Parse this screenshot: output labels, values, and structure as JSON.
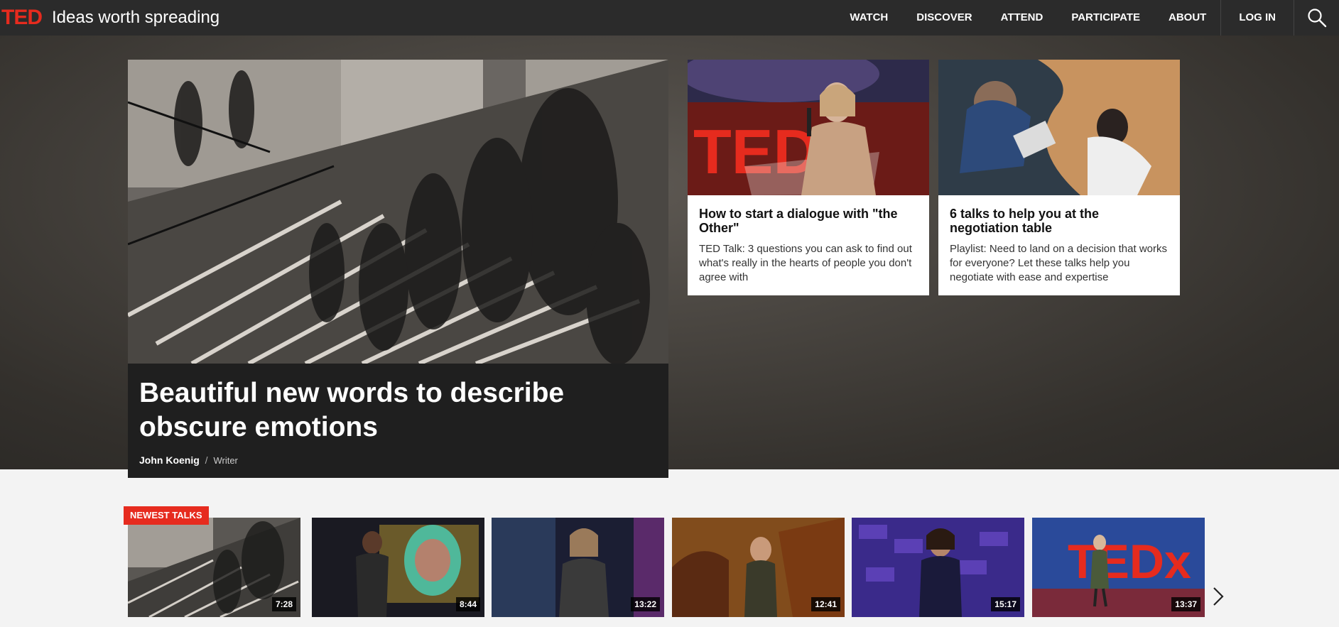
{
  "header": {
    "logo": "TED",
    "tagline": "Ideas worth spreading",
    "nav": [
      "WATCH",
      "DISCOVER",
      "ATTEND",
      "PARTICIPATE",
      "ABOUT"
    ],
    "login": "LOG IN",
    "search_icon": "search-icon"
  },
  "feature": {
    "title": "Beautiful new words to describe obscure emotions",
    "author": "John Koenig",
    "separator": "/",
    "role": "Writer"
  },
  "cards": [
    {
      "title": "How to start a dialogue with \"the Other\"",
      "desc": "TED Talk: 3 questions you can ask to find out what's really in the hearts of people you don't agree with"
    },
    {
      "title": "6 talks to help you at the negotiation table",
      "desc": "Playlist: Need to land on a decision that works for everyone? Let these talks help you negotiate with ease and expertise"
    }
  ],
  "newest": {
    "label": "NEWEST TALKS",
    "talks": [
      {
        "duration": "7:28"
      },
      {
        "duration": "8:44"
      },
      {
        "duration": "13:22"
      },
      {
        "duration": "12:41"
      },
      {
        "duration": "15:17"
      },
      {
        "duration": "13:37"
      }
    ],
    "next_icon": "chevron-right-icon"
  },
  "colors": {
    "brand_red": "#e62b1e",
    "header_bg": "#2b2b2b"
  }
}
